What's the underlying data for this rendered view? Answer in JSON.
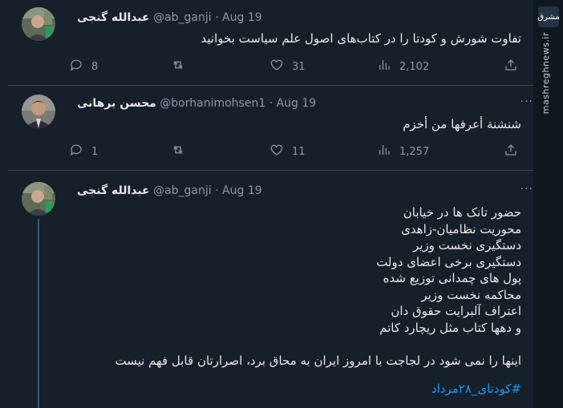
{
  "tweets": [
    {
      "name": "عبدالله گنجی",
      "handle": "@ab_ganji",
      "date": "Aug 19",
      "text": "تفاوت شورش و کودتا را در کتاب‌های اصول علم سیاست بخوانید",
      "replies": "8",
      "retweets": "",
      "likes": "31",
      "views": "2,102"
    },
    {
      "name": "محسن برهانی",
      "handle": "@borhanimohsen1",
      "date": "Aug 19",
      "text": "شنشنة أعرفها من أخزم",
      "replies": "1",
      "retweets": "",
      "likes": "11",
      "views": "1,257"
    },
    {
      "name": "عبدالله گنجی",
      "handle": "@ab_ganji",
      "date": "Aug 19",
      "text": "حضور تانک ها در خیابان\nمحوریت نظامیان-زاهدی\nدستگیری نخست وزیر\nدستگیری برخی اعضای دولت\nپول های چمدانی توزیع شده\nمحاکمه نخست وزیر\nاعتراف آلبرایت حقوق دان\nو دهها کتاب مثل ریچارد کاتم\n\nاینها را نمی شود در لجاجت با امروز ایران به محاق برد، اصرارتان قابل فهم نیست",
      "hashtag": "#کودتای_۲۸مرداد"
    }
  ],
  "more_label": "···",
  "watermark": {
    "logo": "مشرق",
    "text": "mashreghnews.ir"
  },
  "icons": [
    "reply-icon",
    "retweet-icon",
    "like-icon",
    "views-icon",
    "share-icon",
    "more-icon"
  ]
}
